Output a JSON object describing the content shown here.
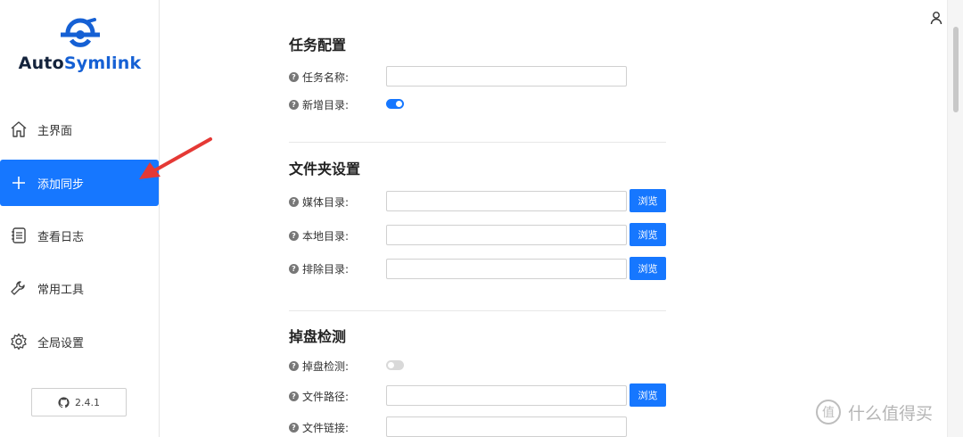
{
  "app": {
    "logo_part1": "Auto",
    "logo_part2": "Symlink",
    "version": "2.4.1"
  },
  "sidebar": {
    "items": [
      {
        "label": "主界面",
        "icon": "home-icon"
      },
      {
        "label": "添加同步",
        "icon": "plus-icon",
        "active": true
      },
      {
        "label": "查看日志",
        "icon": "log-icon"
      },
      {
        "label": "常用工具",
        "icon": "wrench-icon"
      },
      {
        "label": "全局设置",
        "icon": "gear-icon"
      }
    ]
  },
  "colors": {
    "accent": "#1677ff",
    "logo_dark": "#14233c",
    "logo_blue": "#1560d4",
    "arrow": "#e53935"
  },
  "sections": {
    "task": {
      "title": "任务配置",
      "name_label": "任务名称:",
      "name_value": "",
      "new_dir_label": "新增目录:",
      "new_dir_on": true
    },
    "folder": {
      "title": "文件夹设置",
      "media_label": "媒体目录:",
      "local_label": "本地目录:",
      "exclude_label": "排除目录:",
      "browse_label": "浏览"
    },
    "drop": {
      "title": "掉盘检测",
      "detect_label": "掉盘检测:",
      "detect_on": false,
      "path_label": "文件路径:",
      "link_label": "文件链接:",
      "browse_label": "浏览"
    }
  },
  "watermark": {
    "glyph": "值",
    "text": "什么值得买"
  }
}
